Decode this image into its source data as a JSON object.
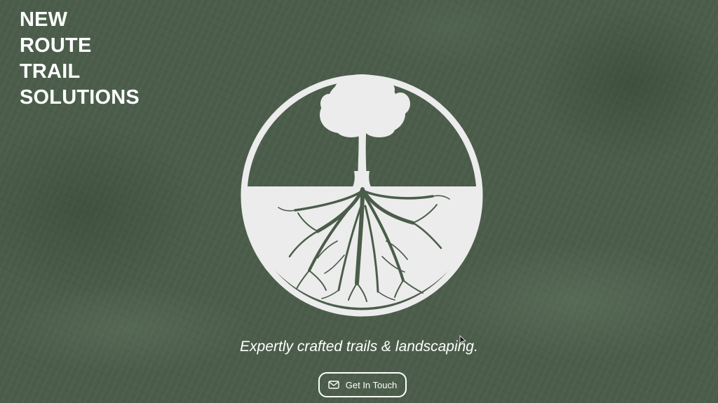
{
  "brand": {
    "line1": "NEW",
    "line2": "ROUTE",
    "line3": "TRAIL",
    "line4": "SOLUTIONS"
  },
  "logo": {
    "icon": "tree-with-roots-icon",
    "circle_color": "#ececec",
    "tree_color": "#ececec",
    "roots_color": "#4b5d4a"
  },
  "hero": {
    "tagline": "Expertly crafted trails & landscaping."
  },
  "cta": {
    "label": "Get In Touch",
    "icon": "mail-icon"
  },
  "colors": {
    "background": "#4b5d4a",
    "text": "#ffffff"
  }
}
